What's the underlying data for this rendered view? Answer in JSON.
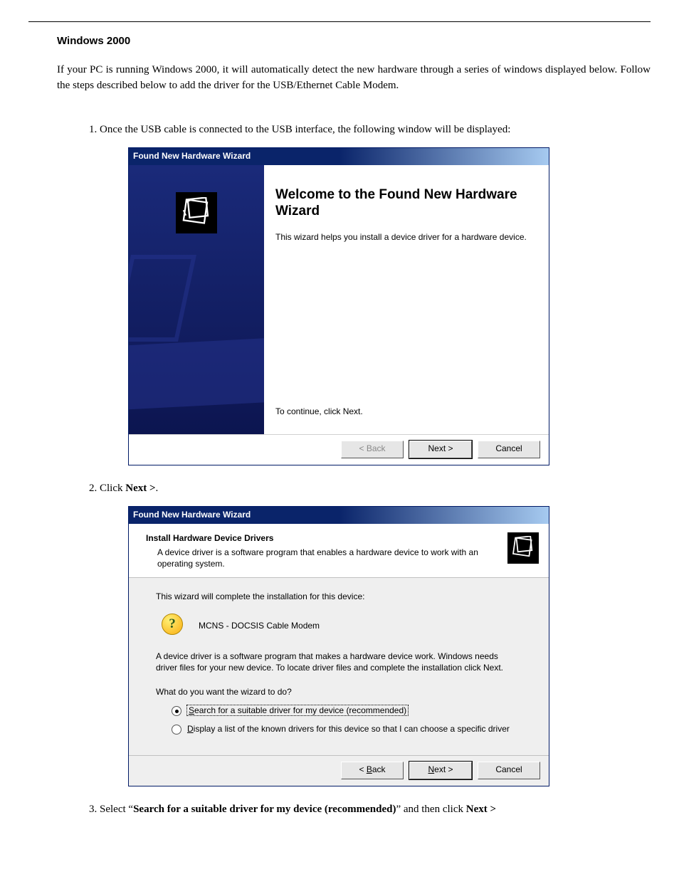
{
  "doc": {
    "section_title": "Windows 2000",
    "intro": "If your PC is running Windows 2000, it will automatically detect the new hardware through a series of windows displayed below. Follow the steps described below to add the driver for the USB/Ethernet Cable Modem.",
    "step1": "Once the USB cable is connected to the USB interface, the following window will be displayed:",
    "step2_pre": "Click ",
    "step2_bold": "Next >",
    "step2_post": ".",
    "step3_pre": "Select “",
    "step3_bold": "Search for a suitable driver for my device (recommended)",
    "step3_mid": "”  and then click ",
    "step3_bold2": "Next >"
  },
  "dlg1": {
    "title": "Found New Hardware Wizard",
    "welcome": "Welcome to the Found New Hardware Wizard",
    "desc": "This wizard helps you install a device driver for a hardware device.",
    "continue": "To continue, click Next.",
    "back": "< Back",
    "next": "Next >",
    "cancel": "Cancel"
  },
  "dlg2": {
    "title": "Found New Hardware Wizard",
    "header_title": "Install Hardware Device Drivers",
    "header_sub": "A device driver is a software program that enables a hardware device to work with an operating system.",
    "complete": "This wizard will complete the installation for this device:",
    "device": "MCNS - DOCSIS Cable Modem",
    "explain": "A device driver is a software program that makes a hardware device work. Windows needs driver files for your new device. To locate driver files and complete the installation click Next.",
    "question": "What do you want the wizard to do?",
    "radios": {
      "search_prefix": "S",
      "search_rest": "earch for a suitable driver for my device (recommended)",
      "display_prefix": "D",
      "display_rest": "isplay a list of the known drivers for this device so that I can choose a specific driver"
    },
    "back_prefix": "< ",
    "back_u": "B",
    "back_rest": "ack",
    "next_u": "N",
    "next_rest": "ext >",
    "cancel": "Cancel"
  }
}
